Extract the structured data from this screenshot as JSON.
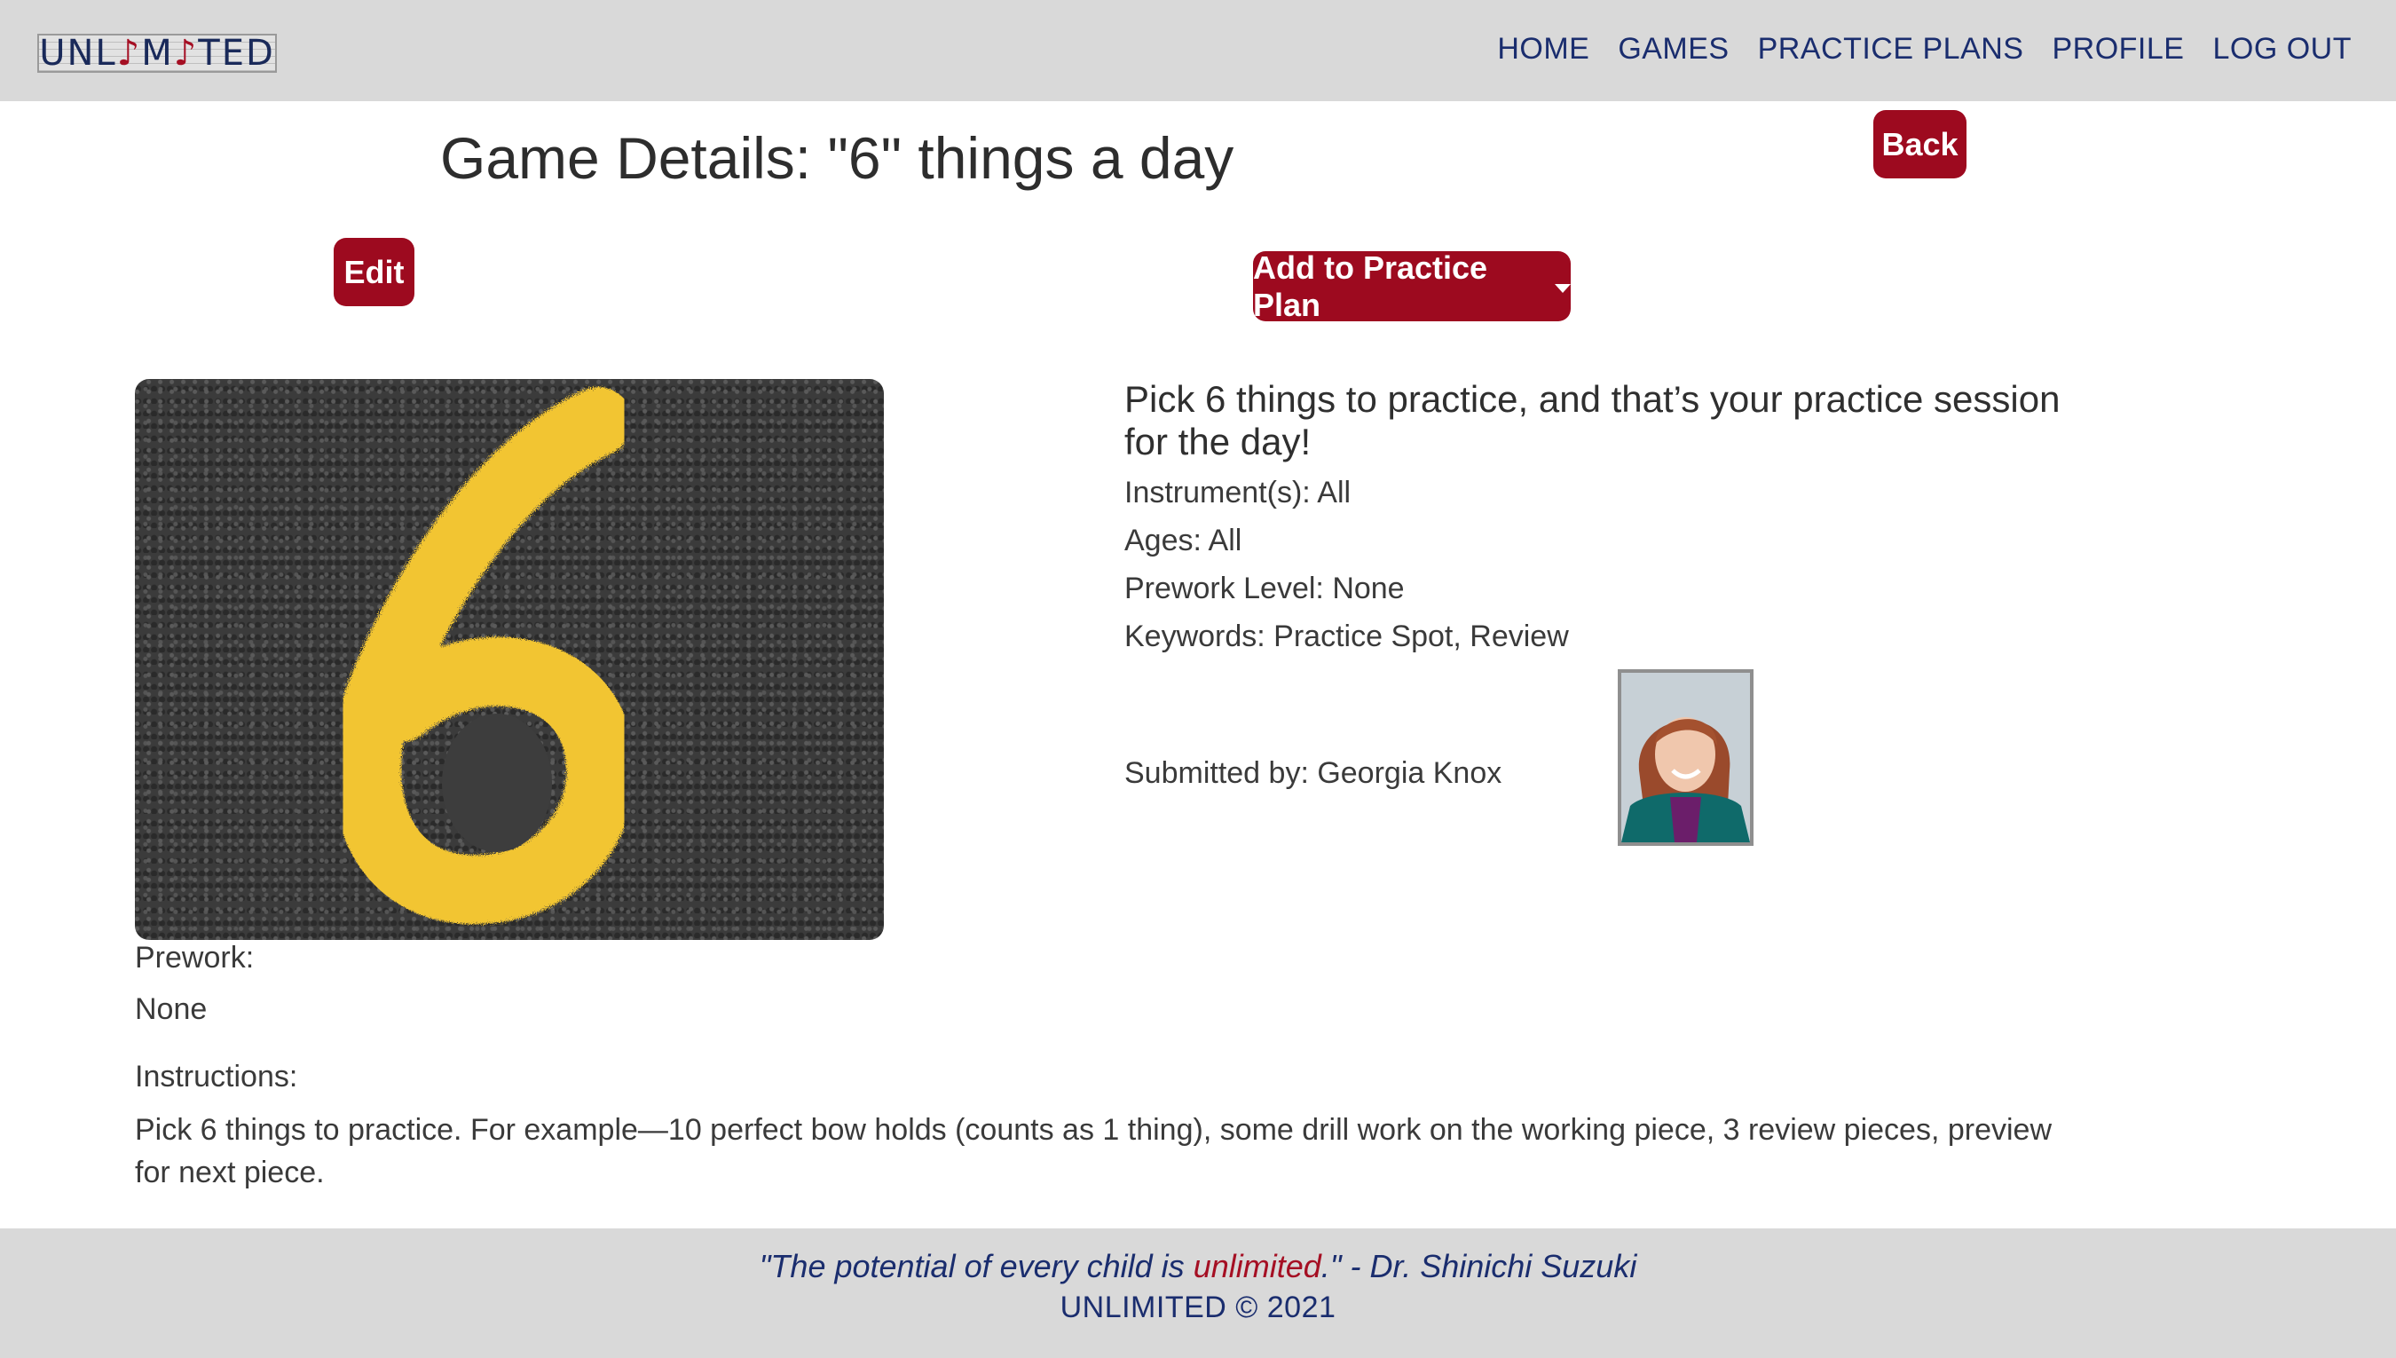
{
  "navbar": {
    "logo": {
      "text": "UNLIMITED",
      "before": "UNL",
      "i1": "♪",
      "mid": "M",
      "i2": "♪",
      "after": "TED"
    },
    "links": [
      "HOME",
      "GAMES",
      "PRACTICE PLANS",
      "PROFILE",
      "LOG OUT"
    ]
  },
  "page": {
    "title": "Game Details: \"6\" things a day",
    "back_label": "Back",
    "edit_label": "Edit",
    "add_plan_label": "Add to Practice Plan"
  },
  "game": {
    "summary": "Pick 6 things to practice, and that’s your practice session for the day!",
    "instruments": "Instrument(s): All",
    "ages": "Ages: All",
    "prework_level": "Prework Level: None",
    "keywords": "Keywords: Practice Spot, Review",
    "submitted_by": "Submitted by: Georgia Knox",
    "image_alt": "number-6-painted-on-asphalt",
    "prework_label": "Prework:",
    "prework_value": "None",
    "instructions_label": "Instructions:",
    "instructions_value": "Pick 6 things to practice. For example—10 perfect bow holds (counts as 1 thing), some drill work on the working piece, 3 review pieces, preview for next piece."
  },
  "footer": {
    "quote_open": "\"The potential of every child is ",
    "quote_highlight": "unlimited",
    "quote_close": ".\" - Dr. Shinichi Suzuki",
    "copyright": "UNLIMITED © 2021"
  },
  "colors": {
    "accent": "#9d0a1f",
    "nav_text": "#1a2d6e",
    "bar_bg": "#d9d9d9"
  }
}
